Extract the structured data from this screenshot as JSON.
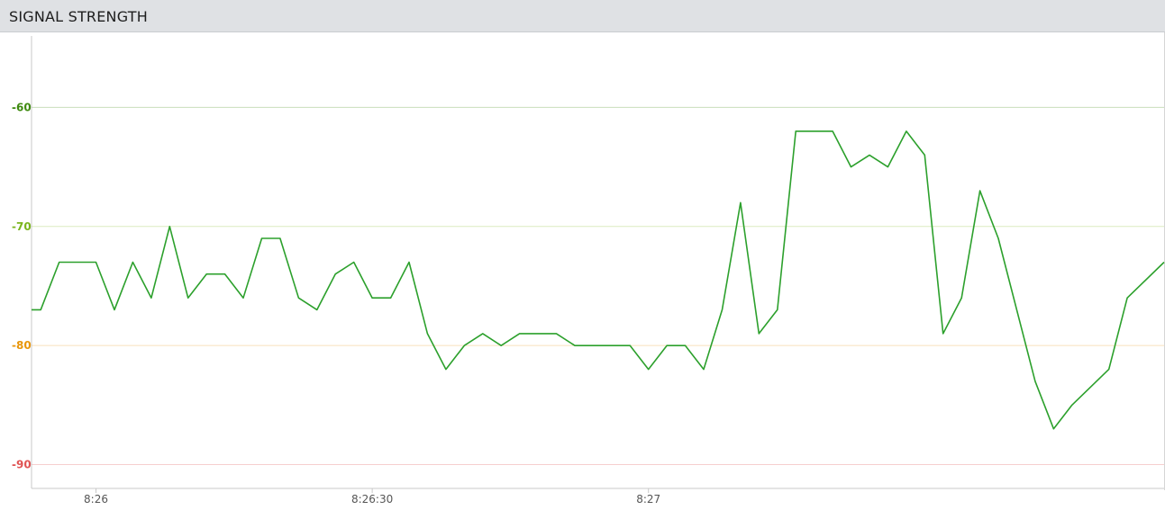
{
  "header": {
    "title": "SIGNAL STRENGTH"
  },
  "chart_data": {
    "type": "line",
    "title": "SIGNAL STRENGTH",
    "xlabel": "",
    "ylabel": "",
    "x_unit": "time",
    "xlim": [
      "8:25:53",
      "8:27:56"
    ],
    "ylim": [
      -92,
      -54
    ],
    "grid": true,
    "legend": "none",
    "y_ticks": [
      {
        "value": -60,
        "label": "-60",
        "color": "#3f8a10"
      },
      {
        "value": -70,
        "label": "-70",
        "color": "#7ab51d"
      },
      {
        "value": -80,
        "label": "-80",
        "color": "#e8960a"
      },
      {
        "value": -90,
        "label": "-90",
        "color": "#e05353"
      }
    ],
    "x_ticks": [
      {
        "value": "8:26",
        "label": "8:26"
      },
      {
        "value": "8:26:30",
        "label": "8:26:30"
      },
      {
        "value": "8:27",
        "label": "8:27"
      }
    ],
    "series": [
      {
        "color": "#2ca02c",
        "points": [
          [
            "8:25:53",
            -77
          ],
          [
            "8:25:54",
            -77
          ],
          [
            "8:25:56",
            -73
          ],
          [
            "8:25:58",
            -73
          ],
          [
            "8:26:00",
            -73
          ],
          [
            "8:26:02",
            -77
          ],
          [
            "8:26:04",
            -73
          ],
          [
            "8:26:06",
            -76
          ],
          [
            "8:26:08",
            -70
          ],
          [
            "8:26:10",
            -76
          ],
          [
            "8:26:12",
            -74
          ],
          [
            "8:26:14",
            -74
          ],
          [
            "8:26:16",
            -76
          ],
          [
            "8:26:18",
            -71
          ],
          [
            "8:26:20",
            -71
          ],
          [
            "8:26:22",
            -76
          ],
          [
            "8:26:24",
            -77
          ],
          [
            "8:26:26",
            -74
          ],
          [
            "8:26:28",
            -73
          ],
          [
            "8:26:30",
            -76
          ],
          [
            "8:26:32",
            -76
          ],
          [
            "8:26:34",
            -73
          ],
          [
            "8:26:36",
            -79
          ],
          [
            "8:26:38",
            -82
          ],
          [
            "8:26:40",
            -80
          ],
          [
            "8:26:42",
            -79
          ],
          [
            "8:26:44",
            -80
          ],
          [
            "8:26:46",
            -79
          ],
          [
            "8:26:48",
            -79
          ],
          [
            "8:26:50",
            -79
          ],
          [
            "8:26:52",
            -80
          ],
          [
            "8:26:54",
            -80
          ],
          [
            "8:26:56",
            -80
          ],
          [
            "8:26:58",
            -80
          ],
          [
            "8:27:00",
            -82
          ],
          [
            "8:27:02",
            -80
          ],
          [
            "8:27:04",
            -80
          ],
          [
            "8:27:06",
            -82
          ],
          [
            "8:27:08",
            -77
          ],
          [
            "8:27:10",
            -68
          ],
          [
            "8:27:12",
            -79
          ],
          [
            "8:27:14",
            -77
          ],
          [
            "8:27:16",
            -62
          ],
          [
            "8:27:18",
            -62
          ],
          [
            "8:27:20",
            -62
          ],
          [
            "8:27:22",
            -65
          ],
          [
            "8:27:24",
            -64
          ],
          [
            "8:27:26",
            -65
          ],
          [
            "8:27:28",
            -62
          ],
          [
            "8:27:30",
            -64
          ],
          [
            "8:27:32",
            -79
          ],
          [
            "8:27:34",
            -76
          ],
          [
            "8:27:36",
            -67
          ],
          [
            "8:27:38",
            -71
          ],
          [
            "8:27:42",
            -83
          ],
          [
            "8:27:44",
            -87
          ],
          [
            "8:27:46",
            -85
          ],
          [
            "8:27:50",
            -82
          ],
          [
            "8:27:52",
            -76
          ],
          [
            "8:27:56",
            -73
          ]
        ]
      }
    ]
  }
}
